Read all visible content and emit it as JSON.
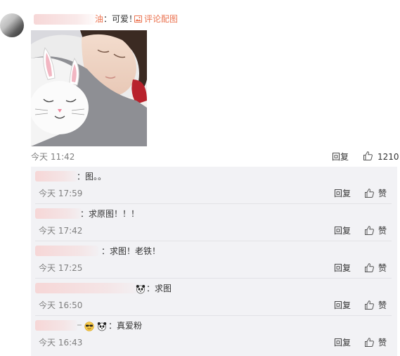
{
  "comment": {
    "name_tail": "油",
    "text": "：可爱！",
    "comment_pic_label": "评论配图",
    "time": "今天 11:42",
    "reply_label": "回复",
    "like_count": "1210"
  },
  "replies": [
    {
      "text": "：图。。",
      "time": "今天 17:59",
      "reply_label": "回复",
      "like_label": "赞"
    },
    {
      "text": "：求原图！！！",
      "time": "今天 17:42",
      "reply_label": "回复",
      "like_label": "赞"
    },
    {
      "text": "：求图！老铁！",
      "time": "今天 17:25",
      "reply_label": "回复",
      "like_label": "赞"
    },
    {
      "text": "：求图",
      "time": "今天 16:50",
      "reply_label": "回复",
      "like_label": "赞"
    },
    {
      "text": "：真爱粉",
      "time": "今天 16:43",
      "reply_label": "回复",
      "like_label": "赞"
    }
  ]
}
